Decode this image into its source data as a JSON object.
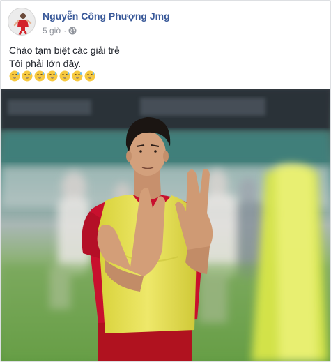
{
  "post": {
    "author": "Nguyễn Công Phượng Jmg",
    "time": "5 giờ",
    "separator": "·",
    "privacy_icon": "globe-icon",
    "text_lines": [
      "Chào tạm biệt các giải trẻ",
      "Tôi phải lớn đây."
    ],
    "emoji_icon": "grinning-sweat-emoji-icon",
    "emoji_count": 7
  },
  "colors": {
    "author_link": "#385898",
    "meta_text": "#90949c",
    "body_text": "#1d2129",
    "bib_yellow": "#e8e04a",
    "shirt_red": "#c8102e",
    "pitch_green": "#6fa44c"
  }
}
